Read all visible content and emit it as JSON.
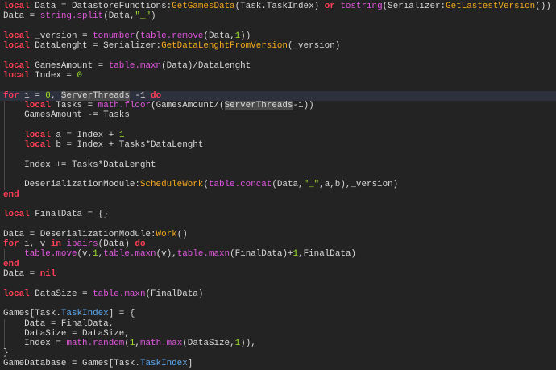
{
  "editor": {
    "current_line": 10,
    "lines": [
      [
        [
          "k",
          "local"
        ],
        [
          "t",
          " Data = DatastoreFunctions:"
        ],
        [
          "m",
          "GetGamesData"
        ],
        [
          "t",
          "(Task.TaskIndex) "
        ],
        [
          "k",
          "or"
        ],
        [
          "t",
          " "
        ],
        [
          "b",
          "tostring"
        ],
        [
          "t",
          "(Serializer:"
        ],
        [
          "m",
          "GetLastestVersion"
        ],
        [
          "t",
          "())"
        ]
      ],
      [
        [
          "t",
          "Data = "
        ],
        [
          "b",
          "string.split"
        ],
        [
          "t",
          "(Data,"
        ],
        [
          "s",
          "\"_\""
        ],
        [
          "t",
          ")"
        ]
      ],
      [],
      [
        [
          "k",
          "local"
        ],
        [
          "t",
          " _version = "
        ],
        [
          "b",
          "tonumber"
        ],
        [
          "t",
          "("
        ],
        [
          "b",
          "table.remove"
        ],
        [
          "t",
          "(Data,"
        ],
        [
          "n",
          "1"
        ],
        [
          "t",
          "))"
        ]
      ],
      [
        [
          "k",
          "local"
        ],
        [
          "t",
          " DataLenght = Serializer:"
        ],
        [
          "m",
          "GetDataLenghtFromVersion"
        ],
        [
          "t",
          "(_version)"
        ]
      ],
      [],
      [
        [
          "k",
          "local"
        ],
        [
          "t",
          " GamesAmount = "
        ],
        [
          "b",
          "table.maxn"
        ],
        [
          "t",
          "(Data)/DataLenght"
        ]
      ],
      [
        [
          "k",
          "local"
        ],
        [
          "t",
          " Index = "
        ],
        [
          "n",
          "0"
        ]
      ],
      [],
      [
        [
          "k",
          "for"
        ],
        [
          "t",
          " i = "
        ],
        [
          "n",
          "0"
        ],
        [
          "t",
          ", "
        ],
        [
          "h",
          "ServerThreads"
        ],
        [
          "t",
          " -1 "
        ],
        [
          "k",
          "do"
        ]
      ],
      [
        [
          "t",
          "    "
        ],
        [
          "k",
          "local"
        ],
        [
          "t",
          " Tasks = "
        ],
        [
          "b",
          "math.floor"
        ],
        [
          "t",
          "(GamesAmount/("
        ],
        [
          "h",
          "ServerThreads"
        ],
        [
          "t",
          "-i))"
        ]
      ],
      [
        [
          "t",
          "    GamesAmount -= Tasks"
        ]
      ],
      [
        [
          "t",
          "    "
        ]
      ],
      [
        [
          "t",
          "    "
        ],
        [
          "k",
          "local"
        ],
        [
          "t",
          " a = Index + "
        ],
        [
          "n",
          "1"
        ]
      ],
      [
        [
          "t",
          "    "
        ],
        [
          "k",
          "local"
        ],
        [
          "t",
          " b = Index + Tasks*DataLenght"
        ]
      ],
      [
        [
          "t",
          "    "
        ]
      ],
      [
        [
          "t",
          "    Index += Tasks*DataLenght"
        ]
      ],
      [
        [
          "t",
          "    "
        ]
      ],
      [
        [
          "t",
          "    DeserializationModule:"
        ],
        [
          "m",
          "ScheduleWork"
        ],
        [
          "t",
          "("
        ],
        [
          "b",
          "table.concat"
        ],
        [
          "t",
          "(Data,"
        ],
        [
          "s",
          "\"_\""
        ],
        [
          "t",
          ",a,b),_version)"
        ]
      ],
      [
        [
          "k",
          "end"
        ]
      ],
      [],
      [
        [
          "k",
          "local"
        ],
        [
          "t",
          " FinalData = {}"
        ]
      ],
      [],
      [
        [
          "t",
          "Data = DeserializationModule:"
        ],
        [
          "m",
          "Work"
        ],
        [
          "t",
          "()"
        ]
      ],
      [
        [
          "k",
          "for"
        ],
        [
          "t",
          " i, v "
        ],
        [
          "k",
          "in"
        ],
        [
          "t",
          " "
        ],
        [
          "b",
          "ipairs"
        ],
        [
          "t",
          "(Data) "
        ],
        [
          "k",
          "do"
        ]
      ],
      [
        [
          "t",
          "    "
        ],
        [
          "b",
          "table.move"
        ],
        [
          "t",
          "(v,"
        ],
        [
          "n",
          "1"
        ],
        [
          "t",
          ","
        ],
        [
          "b",
          "table.maxn"
        ],
        [
          "t",
          "(v),"
        ],
        [
          "b",
          "table.maxn"
        ],
        [
          "t",
          "(FinalData)+"
        ],
        [
          "n",
          "1"
        ],
        [
          "t",
          ",FinalData)"
        ]
      ],
      [
        [
          "k",
          "end"
        ]
      ],
      [
        [
          "t",
          "Data = "
        ],
        [
          "k",
          "nil"
        ]
      ],
      [],
      [
        [
          "k",
          "local"
        ],
        [
          "t",
          " DataSize = "
        ],
        [
          "b",
          "table.maxn"
        ],
        [
          "t",
          "(FinalData)"
        ]
      ],
      [],
      [
        [
          "t",
          "Games[Task."
        ],
        [
          "p",
          "TaskIndex"
        ],
        [
          "t",
          "] = {"
        ]
      ],
      [
        [
          "t",
          "    Data = FinalData,"
        ]
      ],
      [
        [
          "t",
          "    DataSize = DataSize,"
        ]
      ],
      [
        [
          "t",
          "    Index = "
        ],
        [
          "b",
          "math.random"
        ],
        [
          "t",
          "("
        ],
        [
          "n",
          "1"
        ],
        [
          "t",
          ","
        ],
        [
          "b",
          "math.max"
        ],
        [
          "t",
          "(DataSize,"
        ],
        [
          "n",
          "1"
        ],
        [
          "t",
          ")),"
        ]
      ],
      [
        [
          "t",
          "}"
        ]
      ],
      [
        [
          "t",
          "GameDatabase = Games[Task."
        ],
        [
          "p",
          "TaskIndex"
        ],
        [
          "t",
          "]"
        ]
      ]
    ]
  }
}
